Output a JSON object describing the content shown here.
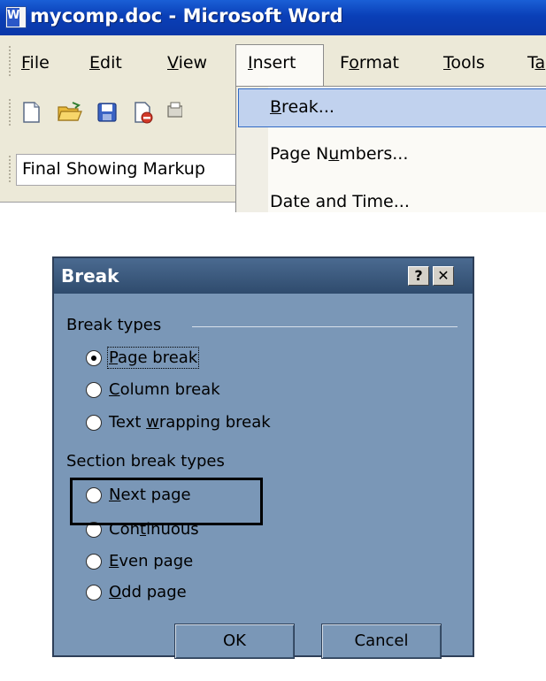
{
  "word": {
    "icon_letter": "W",
    "title": "mycomp.doc - Microsoft Word",
    "menu": {
      "file": {
        "pre": "",
        "key": "F",
        "post": "ile"
      },
      "edit": {
        "pre": "",
        "key": "E",
        "post": "dit"
      },
      "view": {
        "pre": "",
        "key": "V",
        "post": "iew"
      },
      "insert": {
        "pre": "",
        "key": "I",
        "post": "nsert"
      },
      "format": {
        "pre": "F",
        "key": "o",
        "post": "rmat"
      },
      "tools": {
        "pre": "",
        "key": "T",
        "post": "ools"
      },
      "table": {
        "pre": "T",
        "key": "a",
        "post": ""
      }
    },
    "markup_value": "Final Showing Markup",
    "insert_menu": {
      "break": {
        "pre": "",
        "key": "B",
        "post": "reak..."
      },
      "page_numbers": {
        "pre": "Page N",
        "key": "u",
        "post": "mbers..."
      },
      "date_time": {
        "pre": "",
        "key": "",
        "post": "Date and Time..."
      }
    }
  },
  "dialog": {
    "title": "Break",
    "help": "?",
    "close": "✕",
    "break_types_label": "Break types",
    "page_break": {
      "pre": "",
      "key": "P",
      "post": "age break"
    },
    "column_break": {
      "pre": "",
      "key": "C",
      "post": "olumn break"
    },
    "text_wrap": {
      "pre": "Text ",
      "key": "w",
      "post": "rapping break"
    },
    "section_label": "Section break types",
    "next_page": {
      "pre": "",
      "key": "N",
      "post": "ext page"
    },
    "continuous": {
      "pre": "Con",
      "key": "t",
      "post": "inuous"
    },
    "even_page": {
      "pre": "",
      "key": "E",
      "post": "ven page"
    },
    "odd_page": {
      "pre": "",
      "key": "O",
      "post": "dd page"
    },
    "ok": "OK",
    "cancel": "Cancel",
    "selected": "page_break"
  },
  "colors": {
    "titlebar": "#0a3fb7",
    "dialog_bg": "#7a97b7",
    "menu_highlight": "#c1d2ee"
  }
}
